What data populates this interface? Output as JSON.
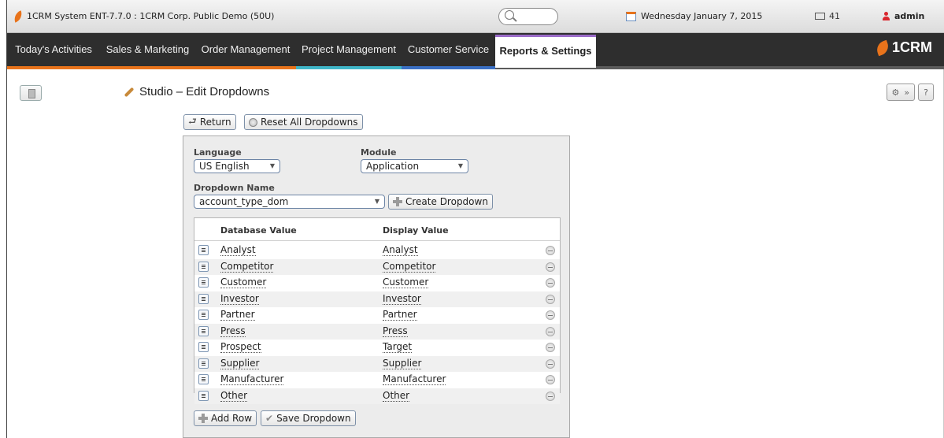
{
  "topbar": {
    "system_title": "1CRM System ENT-7.7.0 : 1CRM Corp. Public Demo (50U)",
    "date": "Wednesday January 7, 2015",
    "mail_count": "41",
    "user": "admin"
  },
  "nav": {
    "tabs": [
      {
        "label": "Today's Activities",
        "color": "#e8731b"
      },
      {
        "label": "Sales & Marketing",
        "color": "#e8731b"
      },
      {
        "label": "Order Management",
        "color": "#e8731b"
      },
      {
        "label": "Project Management",
        "color": "#3fb6c8"
      },
      {
        "label": "Customer Service",
        "color": "#3a6fc4"
      },
      {
        "label": "Reports & Settings",
        "color": "#9b6cc9"
      }
    ],
    "brand": "1CRM"
  },
  "page": {
    "title": "Studio – Edit Dropdowns",
    "return_label": "Return",
    "reset_label": "Reset All Dropdowns"
  },
  "form": {
    "language_label": "Language",
    "language_value": "US English",
    "module_label": "Module",
    "module_value": "Application",
    "dropdown_label": "Dropdown Name",
    "dropdown_value": "account_type_dom",
    "create_label": "Create Dropdown"
  },
  "grid": {
    "col_db": "Database Value",
    "col_display": "Display Value",
    "rows": [
      {
        "db": "Analyst",
        "display": "Analyst"
      },
      {
        "db": "Competitor",
        "display": "Competitor"
      },
      {
        "db": "Customer",
        "display": "Customer"
      },
      {
        "db": "Investor",
        "display": "Investor"
      },
      {
        "db": "Partner",
        "display": "Partner"
      },
      {
        "db": "Press",
        "display": "Press"
      },
      {
        "db": "Prospect",
        "display": "Target"
      },
      {
        "db": "Supplier",
        "display": "Supplier"
      },
      {
        "db": "Manufacturer",
        "display": "Manufacturer"
      },
      {
        "db": "Other",
        "display": "Other"
      }
    ]
  },
  "actions": {
    "add_row_label": "Add Row",
    "save_label": "Save Dropdown"
  }
}
